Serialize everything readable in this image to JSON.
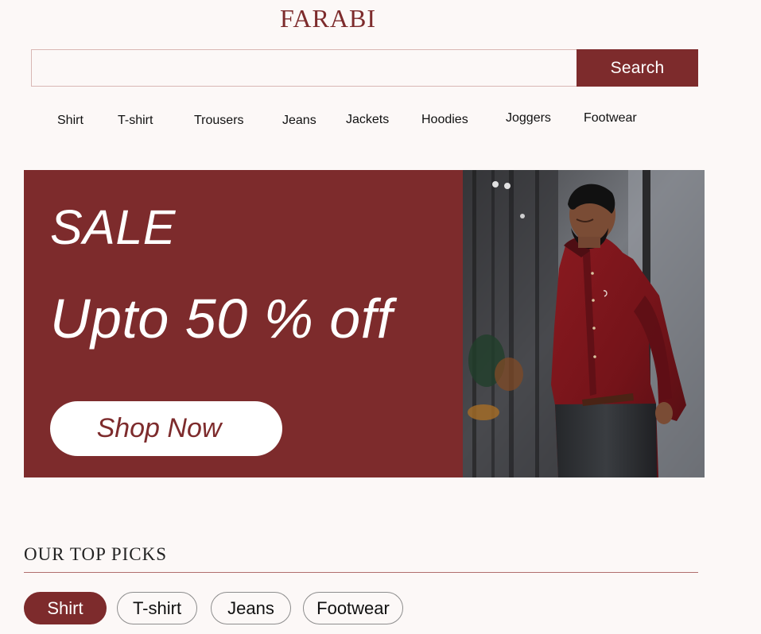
{
  "brand": {
    "name": "FARABI"
  },
  "search": {
    "value": "",
    "placeholder": "",
    "button_label": "Search"
  },
  "nav": {
    "items": [
      {
        "label": "Shirt"
      },
      {
        "label": "T-shirt"
      },
      {
        "label": "Trousers"
      },
      {
        "label": "Jeans"
      },
      {
        "label": "Jackets"
      },
      {
        "label": "Hoodies"
      },
      {
        "label": "Joggers"
      },
      {
        "label": "Footwear"
      }
    ]
  },
  "hero": {
    "sale_label": "SALE",
    "offer_label": "Upto 50 % off",
    "cta_label": "Shop Now"
  },
  "top_picks": {
    "title": "OUR TOP PICKS",
    "chips": [
      {
        "label": "Shirt",
        "active": true
      },
      {
        "label": "T-shirt",
        "active": false
      },
      {
        "label": "Jeans",
        "active": false
      },
      {
        "label": "Footwear",
        "active": false
      }
    ]
  },
  "colors": {
    "brand": "#7d2b2c",
    "background": "#fcf8f7",
    "white": "#ffffff"
  }
}
